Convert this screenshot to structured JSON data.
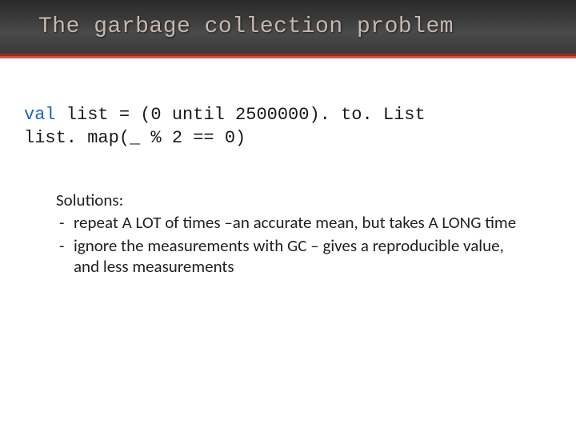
{
  "title": "The garbage collection problem",
  "code": {
    "kw": "val",
    "line1_rest": " list = (0 until 2500000). to. List",
    "line2": "list. map(_ % 2 == 0)"
  },
  "body": {
    "heading": "Solutions:",
    "bullets": [
      "repeat A LOT of times –an accurate mean, but takes A LONG time",
      "ignore the measurements with GC – gives a reproducible value, and less measurements"
    ]
  }
}
